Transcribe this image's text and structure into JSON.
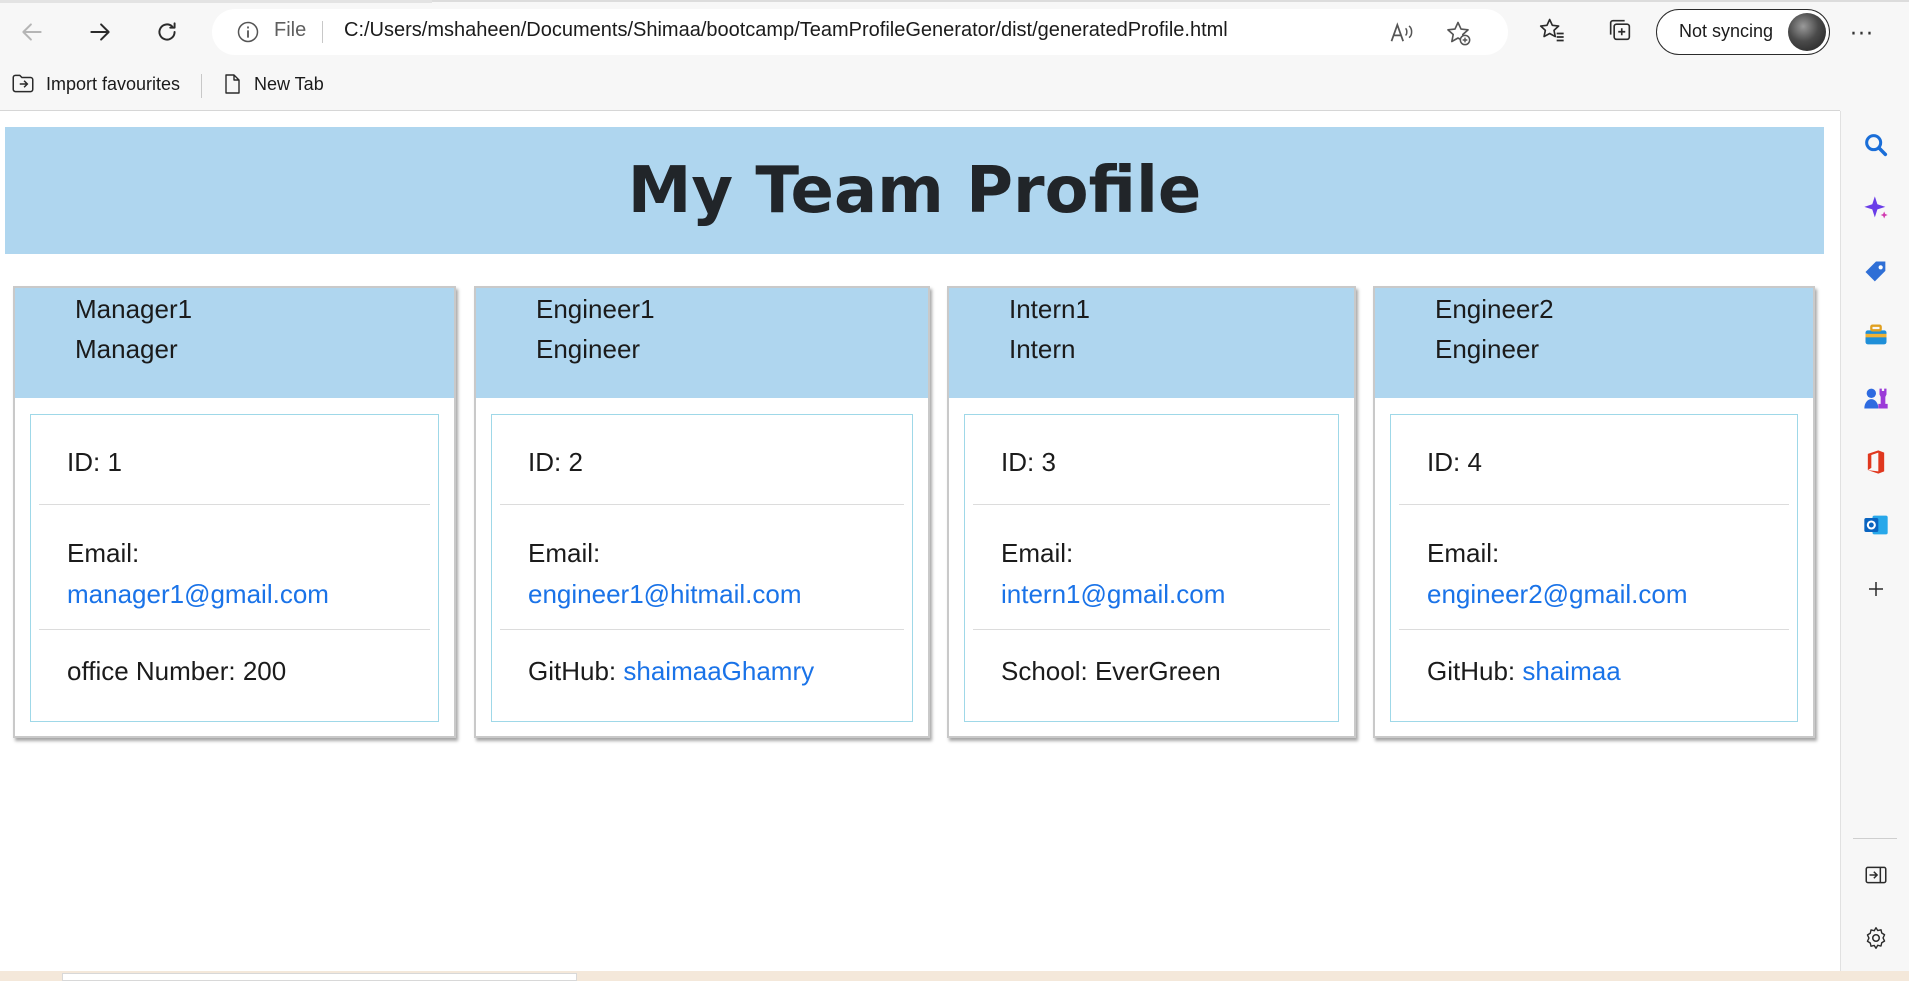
{
  "browser": {
    "address": {
      "scheme_label": "File",
      "url": "C:/Users/mshaheen/Documents/Shimaa/bootcamp/TeamProfileGenerator/dist/generatedProfile.html"
    },
    "sync_label": "Not syncing",
    "more_label": "···",
    "favourites": [
      {
        "label": "Import favourites",
        "icon": "import-favourites-icon"
      },
      {
        "label": "New Tab",
        "icon": "page-icon"
      }
    ],
    "toolbar_icons": [
      "back-icon",
      "forward-icon",
      "refresh-icon",
      "info-icon",
      "read-aloud-icon",
      "add-favourite-icon",
      "favourites-icon",
      "collections-icon"
    ],
    "sidebar_icons": [
      "search-icon",
      "copilot-icon",
      "shopping-icon",
      "tools-icon",
      "games-icon",
      "office-icon",
      "outlook-icon",
      "add-icon",
      "hide-sidebar-icon",
      "settings-icon"
    ]
  },
  "page": {
    "title": "My Team Profile",
    "colors": {
      "header_bg": "#afd6ef",
      "link": "#1a73e8",
      "body_border": "#9fd8e8"
    },
    "employees": [
      {
        "name": "Manager1",
        "role": "Manager",
        "id_text": "ID: 1",
        "email_label": "Email:",
        "email": "manager1@gmail.com",
        "extra_label": "office Number: 200",
        "extra_link": ""
      },
      {
        "name": "Engineer1",
        "role": "Engineer",
        "id_text": "ID: 2",
        "email_label": "Email:",
        "email": "engineer1@hitmail.com",
        "extra_label": "GitHub: ",
        "extra_link": "shaimaaGhamry"
      },
      {
        "name": "Intern1",
        "role": "Intern",
        "id_text": "ID: 3",
        "email_label": "Email:",
        "email": "intern1@gmail.com",
        "extra_label": "School: EverGreen",
        "extra_link": ""
      },
      {
        "name": "Engineer2",
        "role": "Engineer",
        "id_text": "ID: 4",
        "email_label": "Email:",
        "email": "engineer2@gmail.com",
        "extra_label": "GitHub: ",
        "extra_link": "shaimaa"
      }
    ]
  }
}
